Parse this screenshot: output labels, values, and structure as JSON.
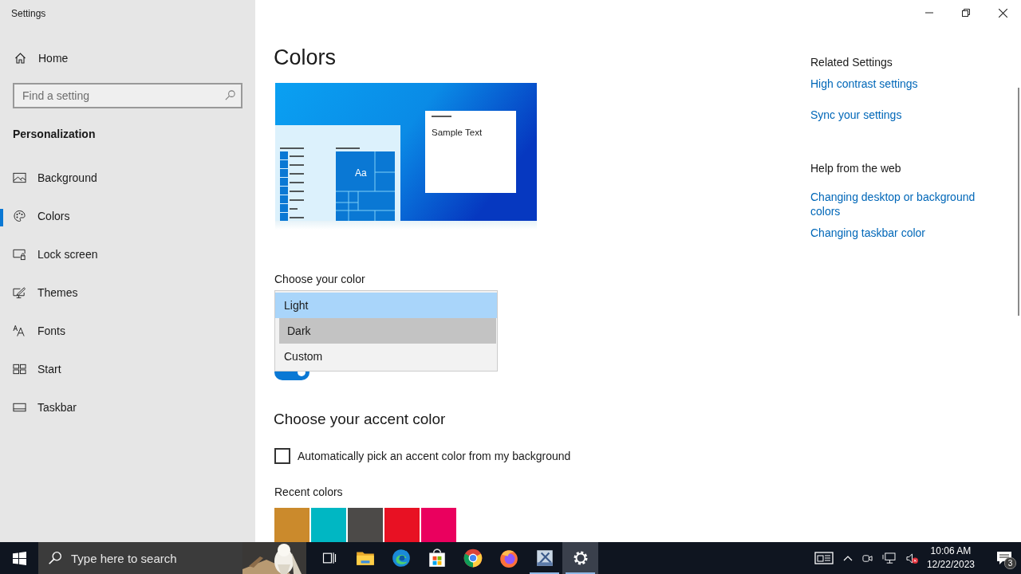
{
  "window": {
    "title": "Settings"
  },
  "sidebar": {
    "home": "Home",
    "search": {
      "placeholder": "Find a setting"
    },
    "section": "Personalization",
    "items": [
      {
        "label": "Background",
        "kind": "picture",
        "selected": false
      },
      {
        "label": "Colors",
        "kind": "palette",
        "selected": true
      },
      {
        "label": "Lock screen",
        "kind": "lock",
        "selected": false
      },
      {
        "label": "Themes",
        "kind": "themes",
        "selected": false
      },
      {
        "label": "Fonts",
        "kind": "fonts",
        "selected": false
      },
      {
        "label": "Start",
        "kind": "start",
        "selected": false
      },
      {
        "label": "Taskbar",
        "kind": "taskbar",
        "selected": false
      }
    ]
  },
  "page": {
    "title": "Colors",
    "preview": {
      "tile_text": "Aa",
      "sample_text": "Sample Text"
    },
    "choose_color": {
      "label": "Choose your color",
      "options": [
        {
          "label": "Light",
          "selected": true,
          "hovered": false
        },
        {
          "label": "Dark",
          "selected": false,
          "hovered": true
        },
        {
          "label": "Custom",
          "selected": false,
          "hovered": false
        }
      ],
      "toggle": {
        "on": true
      }
    },
    "accent": {
      "title": "Choose your accent color",
      "auto_pick": {
        "label": "Automatically pick an accent color from my background",
        "checked": false
      },
      "recent_label": "Recent colors",
      "recent_colors": [
        {
          "color": "#cb8a2c"
        },
        {
          "color": "#00b7c3"
        },
        {
          "color": "#4c4a48"
        },
        {
          "color": "#e81123"
        },
        {
          "color": "#ea005e"
        }
      ]
    }
  },
  "related": {
    "title": "Related Settings",
    "links": [
      "High contrast settings",
      "Sync your settings"
    ]
  },
  "help": {
    "title": "Help from the web",
    "links": [
      "Changing desktop or background colors",
      "Changing taskbar color"
    ]
  },
  "taskbar": {
    "search": {
      "placeholder": "Type here to search"
    },
    "apps": [
      {
        "kind": "task-view",
        "active": false,
        "running": false
      },
      {
        "kind": "folder",
        "active": false,
        "running": false
      },
      {
        "kind": "edge",
        "active": false,
        "running": false
      },
      {
        "kind": "store",
        "active": false,
        "running": false
      },
      {
        "kind": "chrome",
        "active": false,
        "running": false
      },
      {
        "kind": "firefox",
        "active": false,
        "running": false
      },
      {
        "kind": "tool",
        "active": false,
        "running": true
      },
      {
        "kind": "settings",
        "active": true,
        "running": true
      }
    ],
    "time": "10:06 AM",
    "date": "12/22/2023",
    "notifications": "3"
  }
}
